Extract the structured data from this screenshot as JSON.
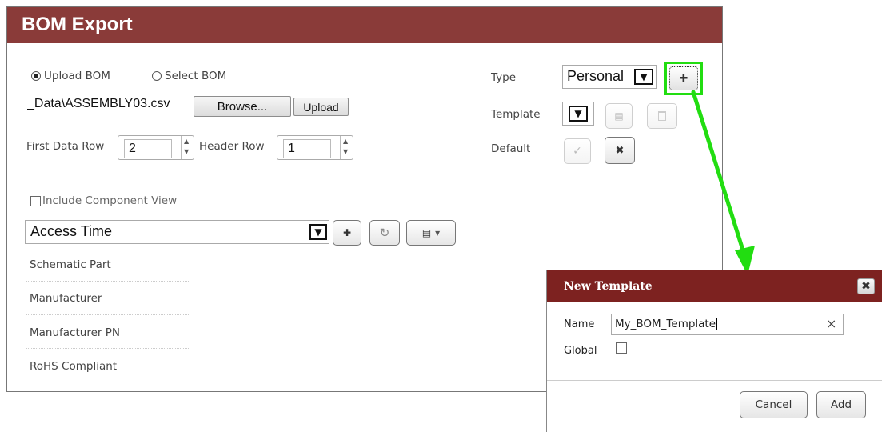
{
  "bom_export": {
    "title": "BOM Export",
    "upload_option": "Upload BOM",
    "select_option": "Select BOM",
    "upload_selected": true,
    "file_name": "_Data\\ASSEMBLY03.csv",
    "browse_label": "Browse...",
    "upload_label": "Upload",
    "first_data_row_label": "First Data Row",
    "first_data_row_value": "2",
    "header_row_label": "Header Row",
    "header_row_value": "1",
    "type_label": "Type",
    "type_value": "Personal",
    "template_label": "Template",
    "template_value": "",
    "default_label": "Default",
    "include_component_view_label": "Include Component View",
    "include_component_view_checked": false,
    "column_select_value": "Access Time",
    "fields": [
      "Schematic Part",
      "Manufacturer",
      "Manufacturer PN",
      "RoHS Compliant"
    ]
  },
  "new_template_dialog": {
    "title": "New Template",
    "close_glyph": "✖",
    "name_label": "Name",
    "name_value": "My_BOM_Template",
    "clear_glyph": "×",
    "global_label": "Global",
    "global_checked": false,
    "cancel_label": "Cancel",
    "add_label": "Add"
  },
  "icons": {
    "plus": "✚",
    "refresh": "↻",
    "save": "▤",
    "delete": "🗑",
    "check": "✓",
    "cross": "✖",
    "caret_down": "▾",
    "select_arrow": "▼"
  },
  "colors": {
    "panel_header": "#8a3b39",
    "dialog_header": "#7d2220",
    "highlight": "#22dd11",
    "arrow": "#22dd11"
  }
}
